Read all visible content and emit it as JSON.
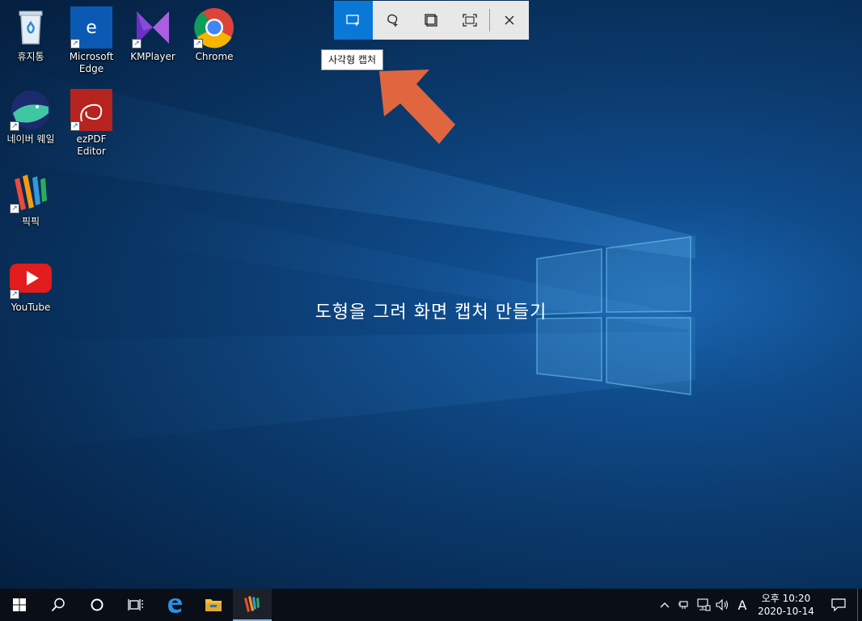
{
  "desktop": {
    "icons": [
      {
        "label": "휴지통",
        "icon": "recycle-bin-icon"
      },
      {
        "label": "Microsoft\nEdge",
        "icon": "edge-legacy-icon"
      },
      {
        "label": "KMPlayer",
        "icon": "kmplayer-icon"
      },
      {
        "label": "Chrome",
        "icon": "chrome-icon"
      },
      {
        "label": "네이버 웨일",
        "icon": "naver-whale-icon"
      },
      {
        "label": "ezPDF Editor",
        "icon": "ezpdf-icon"
      },
      {
        "label": "픽픽",
        "icon": "picpick-icon"
      },
      {
        "label": "YouTube",
        "icon": "youtube-icon"
      }
    ]
  },
  "snip": {
    "modes": [
      {
        "name": "rectangle-snip",
        "icon": "rectangle-snip-icon",
        "active": true
      },
      {
        "name": "freeform-snip",
        "icon": "freeform-snip-icon",
        "active": false
      },
      {
        "name": "window-snip",
        "icon": "window-snip-icon",
        "active": false
      },
      {
        "name": "fullscreen-snip",
        "icon": "fullscreen-snip-icon",
        "active": false
      }
    ],
    "close_icon": "close-icon",
    "tooltip": "사각형 캡처",
    "instruction": "도형을 그려 화면 캡처 만들기",
    "accent_color": "#0a78d7"
  },
  "annotation": {
    "arrow_color": "#e0663f"
  },
  "taskbar": {
    "buttons": [
      "windows-start-icon",
      "search-icon",
      "cortana-icon",
      "task-view-icon",
      "edge-icon",
      "file-explorer-icon",
      "picpick-icon"
    ],
    "tray": {
      "ime": "A",
      "time": "오후 10:20",
      "date": "2020-10-14"
    }
  }
}
